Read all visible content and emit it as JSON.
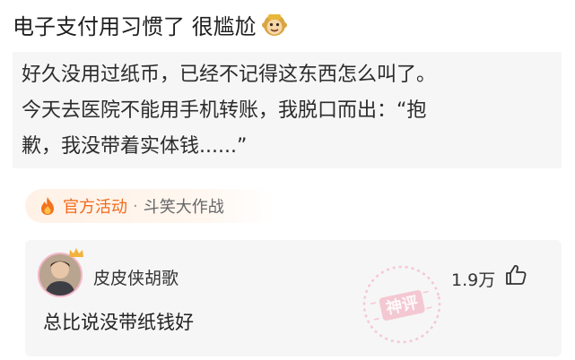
{
  "post": {
    "title": "电子支付用习惯了 很尴尬",
    "title_emoji": "monkey-face-emoji",
    "body_lines": [
      "好久没用过纸币，已经不记得这东西怎么叫了。",
      "今天去医院不能用手机转账，我脱口而出：“抱",
      "歉，我没带着实体钱......”"
    ]
  },
  "activity": {
    "icon": "flame-icon",
    "label": "官方活动",
    "separator": "·",
    "name": "斗笑大作战"
  },
  "comment": {
    "username": "皮皮侠胡歌",
    "likes": "1.9万",
    "text": "总比说没带纸钱好",
    "badge_text": "神评",
    "colors": {
      "stamp": "#f4a3b6",
      "crown": "#f2b33d",
      "avatar_ring": "#f3b6c8"
    }
  },
  "theme": {
    "accent": "#f26a1b",
    "panel": "#f6f6f6"
  }
}
